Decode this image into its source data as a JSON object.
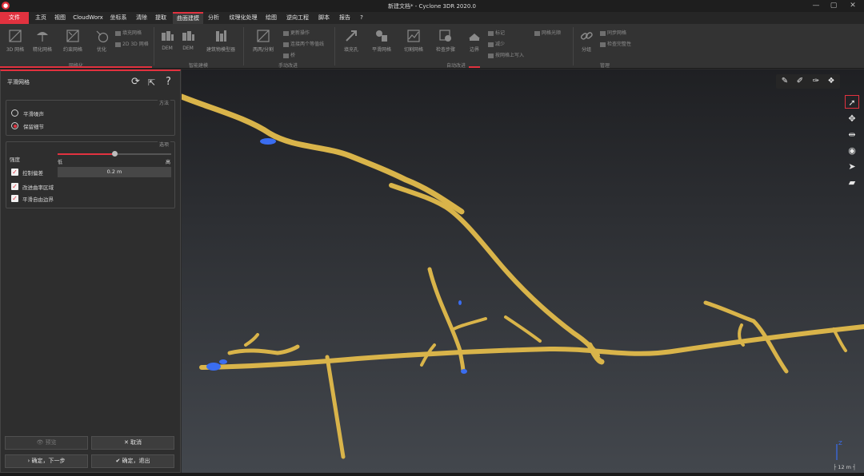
{
  "window": {
    "app_icon": "cyclone-logo-icon",
    "title": "新建文档* - Cyclone 3DR 2020.0",
    "controls": [
      "—",
      "▢",
      "✕"
    ]
  },
  "menu": {
    "file": "文件",
    "items": [
      "主页",
      "视图",
      "CloudWorx",
      "坐标系",
      "清除",
      "提取",
      "曲面建模",
      "分析",
      "纹理化处理",
      "绘图",
      "逆向工程",
      "脚本",
      "报告",
      "?"
    ],
    "active_index": 6
  },
  "ribbon": {
    "buttons": {
      "b1": "3D 网格",
      "b2": "精化网格",
      "b3": "约束网格",
      "b4": "优化",
      "b5": "DEM",
      "b6": "DEM",
      "b7": "建筑物模型器",
      "b8": "两两/分割",
      "b9": "填充孔",
      "b10": "平滑网格",
      "b11": "切割网格",
      "b12": "检查步骤",
      "b13": "边界",
      "b14": "分组"
    },
    "small": {
      "s1": "填充网格",
      "s2": "2D 3D 网格",
      "s3": "更新操作",
      "s4": "连接两个等值线",
      "s5": "桥",
      "s6": "标记",
      "s7": "减少",
      "s8": "按网格上写入",
      "s9": "网格光顺",
      "s10": "同步网格",
      "s11": "检查完整性"
    },
    "groups": {
      "g1": "网格化",
      "g2": "智能建模",
      "g3": "手动改进",
      "g4": "自动改进",
      "g5": "管理"
    }
  },
  "panel": {
    "title": "平滑网格",
    "methods_legend": "方法",
    "method_1": "平滑噪声",
    "method_2": "保留细节",
    "selected_method": 2,
    "options_legend": "选项",
    "strength_label": "强度",
    "slider_low": "低",
    "slider_high": "高",
    "slider_fraction": 0.5,
    "control_deviation": "控制偏差",
    "deviation_value": "0.2 m",
    "allow_vertex_region": "改进曲率区域",
    "smooth_free_border": "平滑自由边界",
    "btn_preview": "预览",
    "btn_cancel": "取消",
    "btn_next": "确定，下一步",
    "btn_exit": "确定，退出"
  },
  "viewport": {
    "scale": "12 m",
    "axis_label": "Z",
    "mesh_color": "#d9b44a",
    "highlight_color": "#3a6df0",
    "accent": "#e2323f"
  }
}
